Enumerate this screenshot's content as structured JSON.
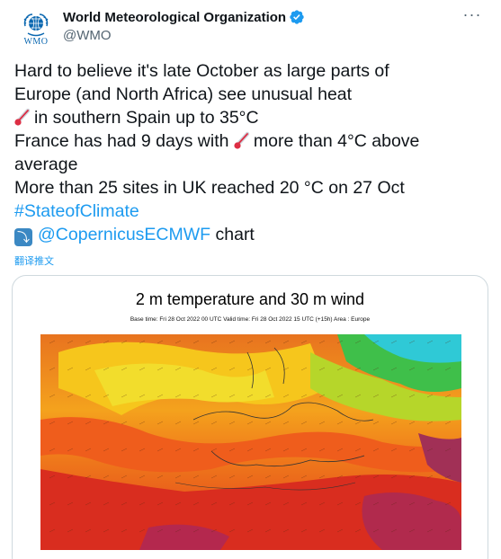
{
  "account": {
    "display_name": "World Meteorological Organization",
    "handle": "@WMO",
    "avatar_label": "WMO",
    "verified": true
  },
  "tweet": {
    "line1": "Hard to believe it's late October as large parts of",
    "line2": "Europe (and North Africa) see unusual heat",
    "line3": "in southern Spain up to 35°C",
    "line4a": "France has had 9 days with",
    "line4b": "more than 4°C above",
    "line5": "average",
    "line6": "More than 25 sites in UK reached 20 °C on 27 Oct",
    "hashtag": "#StateofClimate",
    "mention": "@CopernicusECMWF",
    "line8_tail": "chart",
    "translate_label": "翻译推文"
  },
  "media": {
    "chart_title": "2 m temperature and 30 m wind",
    "chart_subtitle": "Base time: Fri 28 Oct 2022 00 UTC Valid time: Fri 28 Oct 2022 15 UTC (+15h) Area : Europe"
  },
  "icons": {
    "verified": "verified-badge-icon",
    "more": "more-options-icon",
    "thermometer": "thermometer-emoji",
    "arrow": "arrow-down-right-emoji"
  },
  "colors": {
    "link": "#1d9bf0",
    "text": "#0f1419",
    "secondary": "#536471",
    "verified": "#1d9bf0"
  }
}
